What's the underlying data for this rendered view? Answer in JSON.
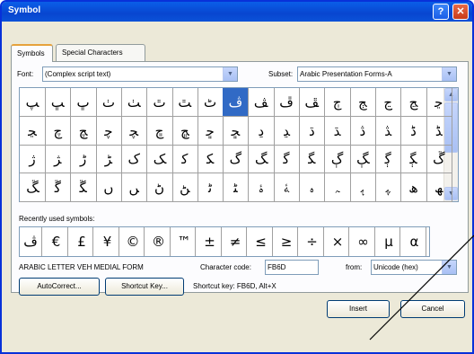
{
  "window": {
    "title": "Symbol",
    "help_glyph": "?",
    "close_glyph": "✕"
  },
  "tabs": [
    {
      "label": "Symbols",
      "active": true
    },
    {
      "label": "Special Characters",
      "active": false
    }
  ],
  "font": {
    "label": "Font:",
    "value": "(Complex script text)"
  },
  "subset": {
    "label": "Subset:",
    "value": "Arabic Presentation Forms-A"
  },
  "symbol_rows": [
    [
      "ﭗ",
      "ﭛ",
      "ﭚ",
      "ﭞ",
      "ﭟ",
      "ﭢ",
      "ﭣ",
      "ﭦ",
      "ﭪ",
      "ﭫ",
      "ﭮ",
      "ﭯ",
      "ﭲ",
      "ﭳ",
      "ﭶ",
      "ﭷ",
      "ﭸ"
    ],
    [
      "ﭹ",
      "ﭺ",
      "ﭻ",
      "ﭼ",
      "ﭽ",
      "ﭾ",
      "ﭿ",
      "ﮀ",
      "ﮁ",
      "ﮂ",
      "ﮃ",
      "ﮄ",
      "ﮅ",
      "ﮆ",
      "ﮇ",
      "ﮈ",
      "ﮉ"
    ],
    [
      "ﮊ",
      "ﮋ",
      "ﮌ",
      "ﮍ",
      "ﮎ",
      "ﮏ",
      "ﮐ",
      "ﮑ",
      "ﮒ",
      "ﮓ",
      "ﮔ",
      "ﮕ",
      "ﮖ",
      "ﮗ",
      "ﮘ",
      "ﮙ",
      "ﮚ"
    ],
    [
      "ﮛ",
      "ﮜ",
      "ﮝ",
      "ﮞ",
      "ﮟ",
      "ﮠ",
      "ﮡ",
      "ﮢ",
      "ﮣ",
      "ﮤ",
      "ﮥ",
      "ﮦ",
      "ﮧ",
      "ﮨ",
      "ﮩ",
      "ﮪ",
      "ﮫ"
    ]
  ],
  "selected_cell": {
    "row": 0,
    "col": 8
  },
  "recent": {
    "label": "Recently used symbols:",
    "symbols": [
      "ﭪ",
      "€",
      "£",
      "¥",
      "©",
      "®",
      "™",
      "±",
      "≠",
      "≤",
      "≥",
      "÷",
      "×",
      "∞",
      "µ",
      "α"
    ]
  },
  "char_name": "ARABIC LETTER VEH MEDIAL FORM",
  "char_code": {
    "label": "Character code:",
    "value": "FB6D"
  },
  "from": {
    "label": "from:",
    "value": "Unicode (hex)"
  },
  "buttons": {
    "autocorrect": "AutoCorrect...",
    "shortcut_key": "Shortcut Key...",
    "insert": "Insert",
    "cancel": "Cancel"
  },
  "shortcut_text": "Shortcut key: FB6D, Alt+X",
  "scroll": {
    "up": "▲",
    "down": "▼"
  },
  "drop_glyph": "▼"
}
